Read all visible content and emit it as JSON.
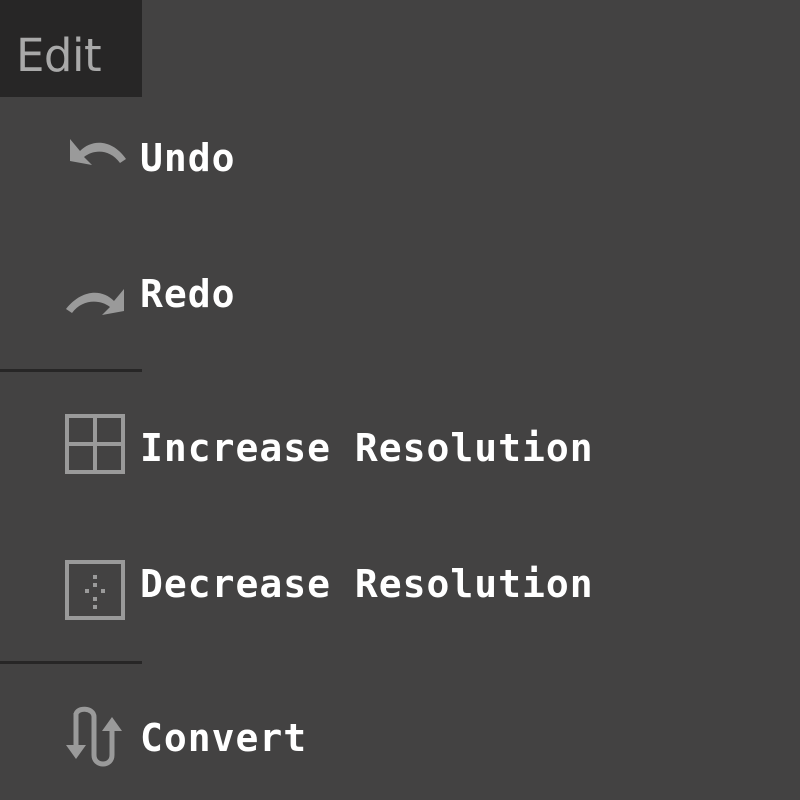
{
  "menu": {
    "title": "Edit"
  },
  "items": [
    {
      "label": "Undo",
      "icon": "undo-icon"
    },
    {
      "label": "Redo",
      "icon": "redo-icon"
    },
    {
      "label": "Increase Resolution",
      "icon": "grid-icon"
    },
    {
      "label": "Decrease Resolution",
      "icon": "dotted-grid-icon"
    },
    {
      "label": "Convert",
      "icon": "convert-arrows-icon"
    }
  ],
  "colors": {
    "background": "#434242",
    "menu_tab": "#272626",
    "divider": "#272626",
    "icon": "#9a9a9a",
    "label": "#ffffff",
    "title": "#a9a9a9"
  }
}
